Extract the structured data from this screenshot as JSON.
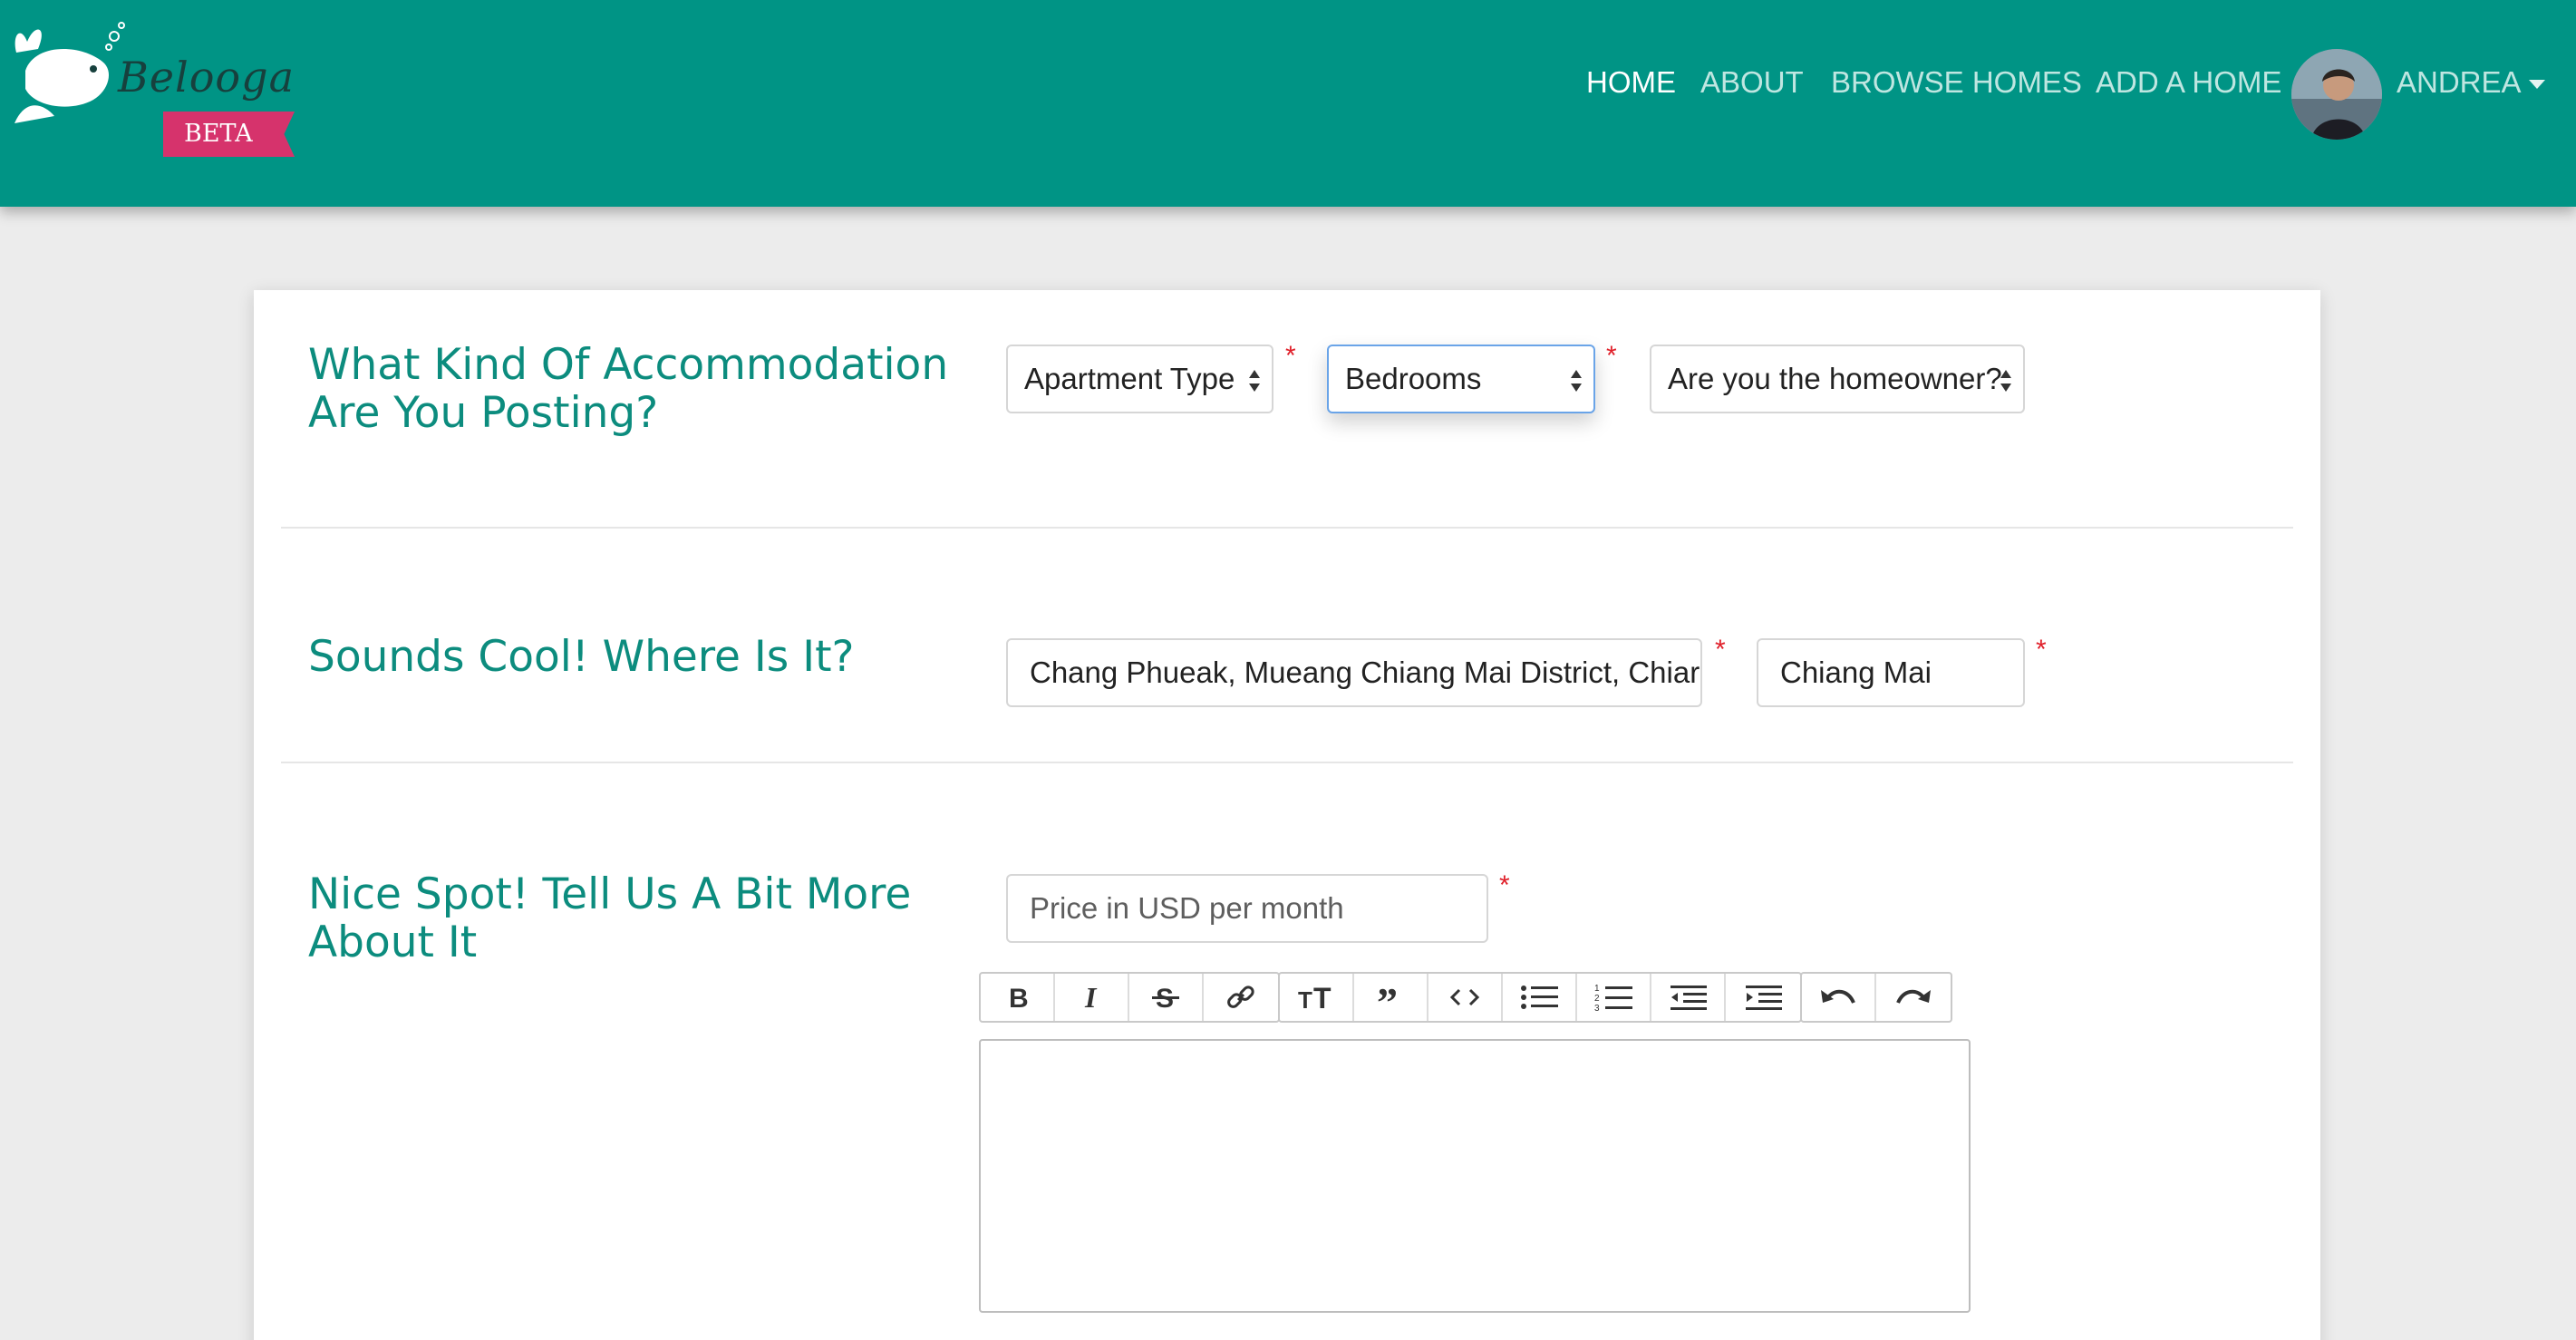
{
  "brand": {
    "name": "Belooga",
    "badge": "BETA",
    "color": "#009485",
    "badge_color": "#d6336c"
  },
  "nav": {
    "home": "HOME",
    "about": "ABOUT",
    "browse": "BROWSE HOMES",
    "add": "ADD A HOME",
    "user": "ANDREA"
  },
  "sections": {
    "accommodation": {
      "title": "What Kind Of Accommodation Are You Posting?",
      "apartment_type": "Apartment Type",
      "bedrooms": "Bedrooms",
      "homeowner": "Are you the homeowner?"
    },
    "location": {
      "title": "Sounds Cool! Where Is It?",
      "address": "Chang Phueak, Mueang Chiang Mai District, Chiar",
      "city": "Chiang Mai"
    },
    "details": {
      "title": "Nice Spot! Tell Us A Bit More About It",
      "price_placeholder": "Price in USD per month"
    }
  },
  "required_mark": "*",
  "toolbar": {
    "groups": [
      [
        "bold-icon",
        "italic-icon",
        "strikethrough-icon",
        "link-icon"
      ],
      [
        "heading-icon",
        "quote-icon",
        "code-icon",
        "bullet-list-icon",
        "numbered-list-icon",
        "outdent-icon",
        "indent-icon"
      ],
      [
        "undo-icon",
        "redo-icon"
      ]
    ]
  },
  "colors": {
    "accent": "#0c8c7e",
    "required": "#e0202a",
    "focus": "#6aa4e8"
  }
}
